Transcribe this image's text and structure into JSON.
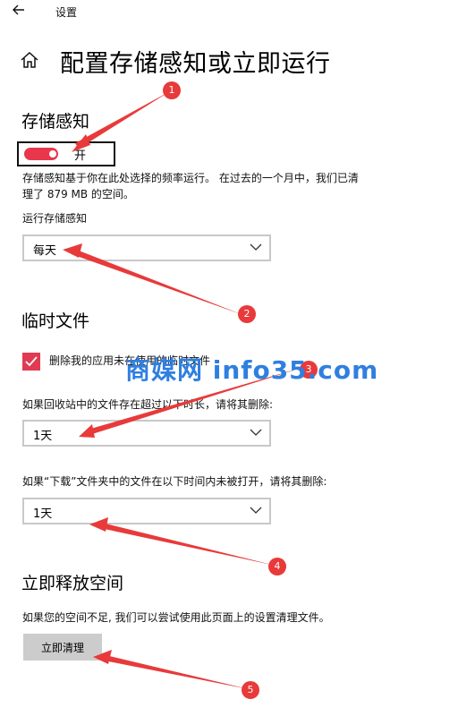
{
  "window": {
    "title": "设置",
    "back_icon": "back-arrow-icon"
  },
  "header": {
    "home_icon": "home-icon",
    "title": "配置存储感知或立即运行"
  },
  "storage_sense": {
    "heading": "存储感知",
    "toggle_label": "开",
    "toggle_on": true,
    "description_line1": "存储感知基于你在此处选择的频率运行。 在过去的一个月中，我们已清",
    "description_line2": "理了 879 MB 的空间。",
    "run_label": "运行存储感知",
    "run_value": "每天"
  },
  "temp_files": {
    "heading": "临时文件",
    "checkbox_label": "删除我的应用未在使用的临时文件",
    "checkbox_checked": true,
    "recycle_label": "如果回收站中的文件存在超过以下时长，请将其删除:",
    "recycle_value": "1天",
    "downloads_label": "如果“下载”文件夹中的文件在以下时间内未被打开，请将其删除:",
    "downloads_value": "1天"
  },
  "free_space": {
    "heading": "立即释放空间",
    "description": "如果您的空间不足, 我们可以尝试使用此页面上的设置清理文件。",
    "button_label": "立即清理"
  },
  "annotations": {
    "badges": [
      "1",
      "2",
      "3",
      "4",
      "5"
    ],
    "watermark": "商媒网 info35.com"
  },
  "colors": {
    "accent": "#e8374d",
    "annotation": "#e83a3a",
    "watermark": "#2f7fe0"
  }
}
